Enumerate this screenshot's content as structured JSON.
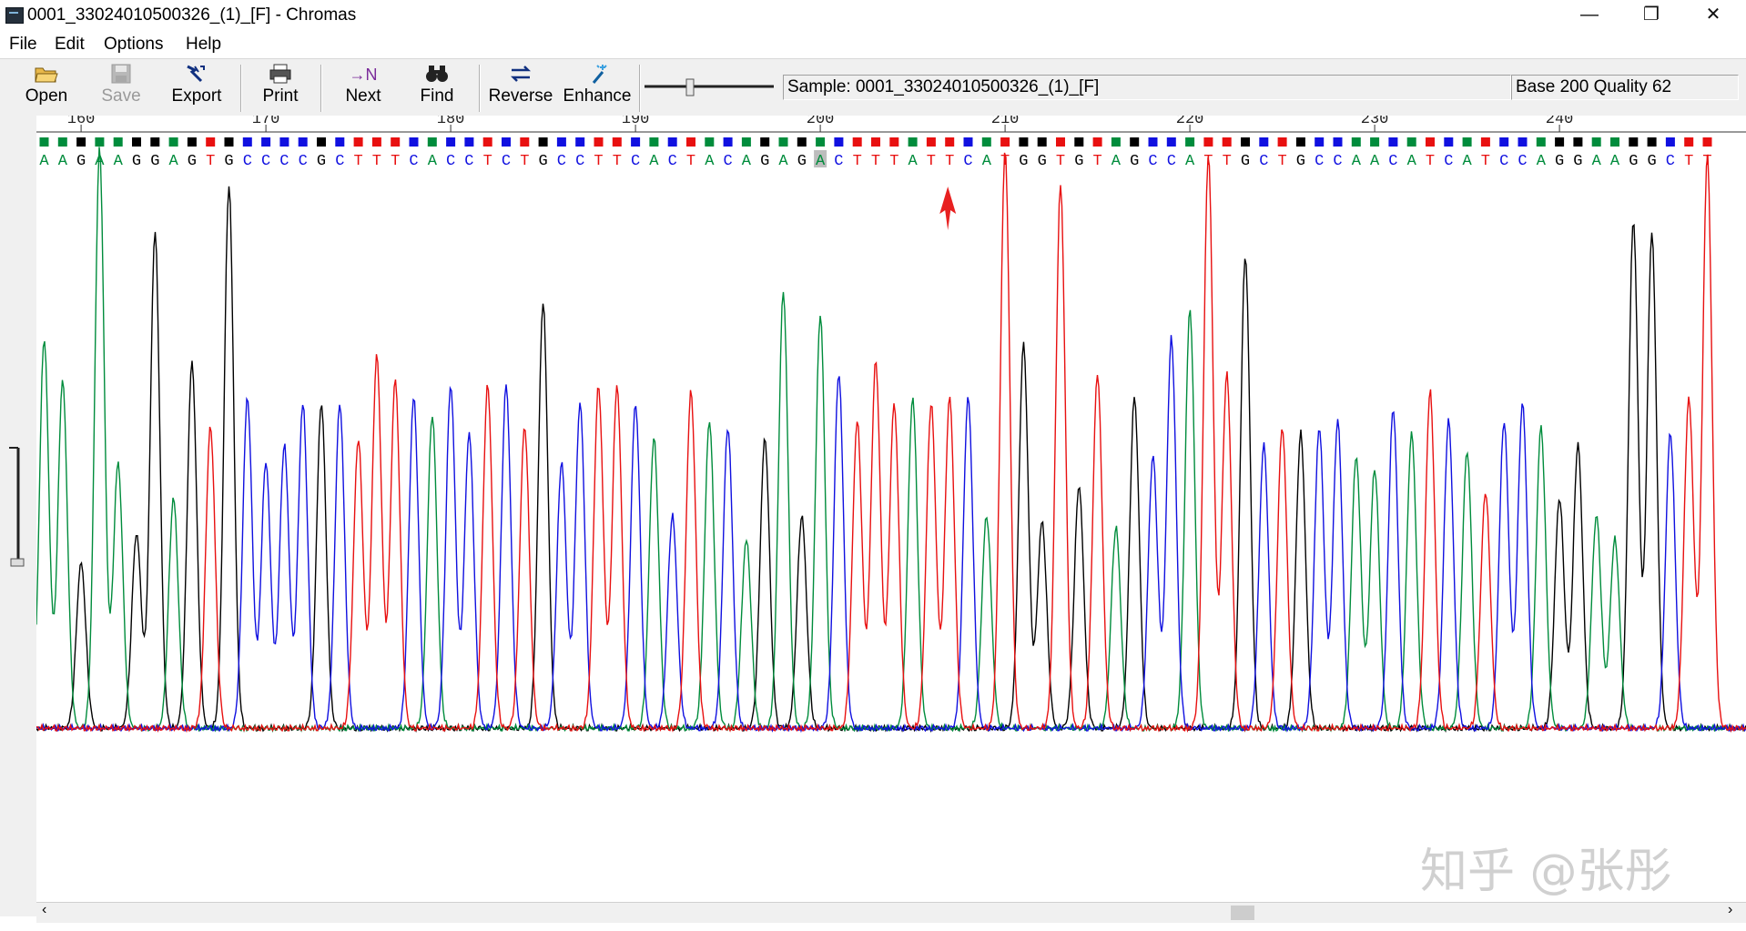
{
  "window": {
    "title": "0001_33024010500326_(1)_[F] - Chromas"
  },
  "menu": [
    "File",
    "Edit",
    "Options",
    "Help"
  ],
  "toolbar": [
    {
      "label": "Open",
      "icon": "folder-open-icon",
      "enabled": true
    },
    {
      "label": "Save",
      "icon": "floppy-disk-icon",
      "enabled": false
    },
    {
      "label": "Export",
      "icon": "export-arrow-icon",
      "enabled": true
    },
    {
      "label": "Print",
      "icon": "printer-icon",
      "enabled": true
    },
    {
      "label": "Next",
      "icon": "next-n-icon",
      "enabled": true
    },
    {
      "label": "Find",
      "icon": "binoculars-icon",
      "enabled": true
    },
    {
      "label": "Reverse",
      "icon": "reverse-arrows-icon",
      "enabled": true
    },
    {
      "label": "Enhance",
      "icon": "magic-wand-icon",
      "enabled": true
    }
  ],
  "status": {
    "sample": "Sample: 0001_33024010500326_(1)_[F]",
    "base_quality": "Base 200  Quality 62"
  },
  "trace": {
    "sequence": "AAGAAGGAGTGCCCCGCTTTCACCTCTGCCTTCACTACAGAGACTTTATTCATGGTGTAGCCATTGCTGCCAACATCATCCAGGAAGGCTT",
    "first_base_number": 158,
    "ruler_ticks": [
      "160",
      "170",
      "180",
      "190",
      "200",
      "210",
      "220",
      "230",
      "240"
    ],
    "selected_base": 200,
    "arrow_base": 207,
    "colors": {
      "A": "#008c3c",
      "C": "#1010e0",
      "G": "#000000",
      "T": "#e81010"
    },
    "quality_colors": {
      "high": "good",
      "low": "A-green/C-blue/G-black/T-red"
    },
    "peak_heights": [
      0.66,
      0.59,
      0.28,
      0.98,
      0.45,
      0.33,
      0.84,
      0.39,
      0.62,
      0.51,
      0.92,
      0.56,
      0.45,
      0.48,
      0.55,
      0.55,
      0.55,
      0.49,
      0.63,
      0.59,
      0.56,
      0.53,
      0.58,
      0.5,
      0.58,
      0.58,
      0.51,
      0.72,
      0.45,
      0.55,
      0.58,
      0.58,
      0.55,
      0.49,
      0.36,
      0.57,
      0.52,
      0.51,
      0.32,
      0.49,
      0.74,
      0.36,
      0.7,
      0.6,
      0.52,
      0.62,
      0.55,
      0.56,
      0.55,
      0.56,
      0.56,
      0.36,
      0.98,
      0.65,
      0.35,
      0.92,
      0.41,
      0.6,
      0.34,
      0.56,
      0.46,
      0.66,
      0.71,
      0.97,
      0.6,
      0.8,
      0.48,
      0.51,
      0.5,
      0.51,
      0.52,
      0.46,
      0.44,
      0.54,
      0.5,
      0.57,
      0.52,
      0.47,
      0.4,
      0.52,
      0.55,
      0.51,
      0.39,
      0.48,
      0.36,
      0.32,
      0.86,
      0.84,
      0.5,
      0.56,
      0.97,
      0.52,
      0.4
    ]
  },
  "watermark": "知乎 @张彤"
}
